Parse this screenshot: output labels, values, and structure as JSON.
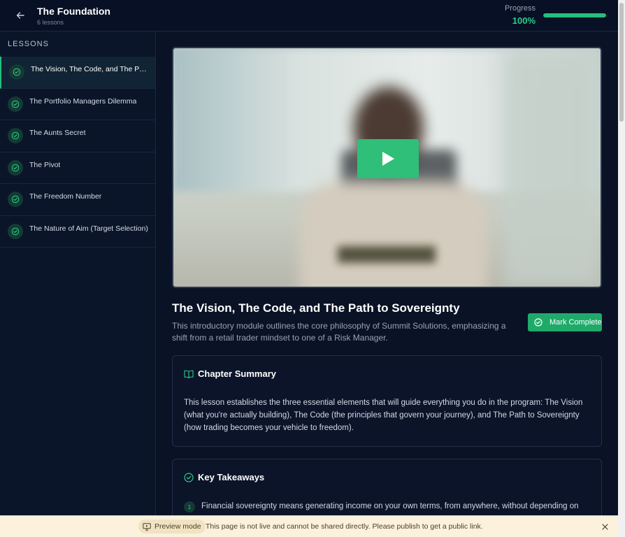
{
  "header": {
    "course_title": "The Foundation",
    "lesson_count": "6 lessons",
    "progress_label": "Progress",
    "progress_value": "100%",
    "progress_fraction": 1.0
  },
  "sidebar": {
    "heading": "LESSONS",
    "items": [
      {
        "label": "The Vision, The Code, and The Path to Sovereignty",
        "completed": true,
        "active": true
      },
      {
        "label": "The Portfolio Managers Dilemma",
        "completed": true,
        "active": false
      },
      {
        "label": "The Aunts Secret",
        "completed": true,
        "active": false
      },
      {
        "label": "The Pivot",
        "completed": true,
        "active": false
      },
      {
        "label": "The Freedom Number",
        "completed": true,
        "active": false
      },
      {
        "label": "The Nature of Aim (Target Selection)",
        "completed": true,
        "active": false
      }
    ]
  },
  "lesson": {
    "title": "The Vision, The Code, and The Path to Sovereignty",
    "description": "This introductory module outlines the core philosophy of Summit Solutions, emphasizing a shift from a retail trader mindset to one of a Risk Manager.",
    "mark_complete_label": "Mark Complete"
  },
  "summary": {
    "title": "Chapter Summary",
    "body": "This lesson establishes the three essential elements that will guide everything you do in the program: The Vision (what you're actually building), The Code (the principles that govern your journey), and The Path to Sovereignty (how trading becomes your vehicle to freedom)."
  },
  "takeaways": {
    "title": "Key Takeaways",
    "items": [
      {
        "num": "1",
        "text": "Financial sovereignty means generating income on your own terms, from anywhere, without depending on"
      }
    ]
  },
  "preview": {
    "pill_label": "Preview mode",
    "message": "This page is not live and cannot be shared directly. Please publish to get a public link."
  },
  "colors": {
    "accent": "#22c07b",
    "background": "#0a1226",
    "banner": "#fbf1dc"
  },
  "icons": {
    "back": "arrow-left-icon",
    "check": "check-circle-icon",
    "play": "play-icon",
    "book": "book-open-icon",
    "preview": "monitor-icon",
    "close": "close-icon"
  }
}
